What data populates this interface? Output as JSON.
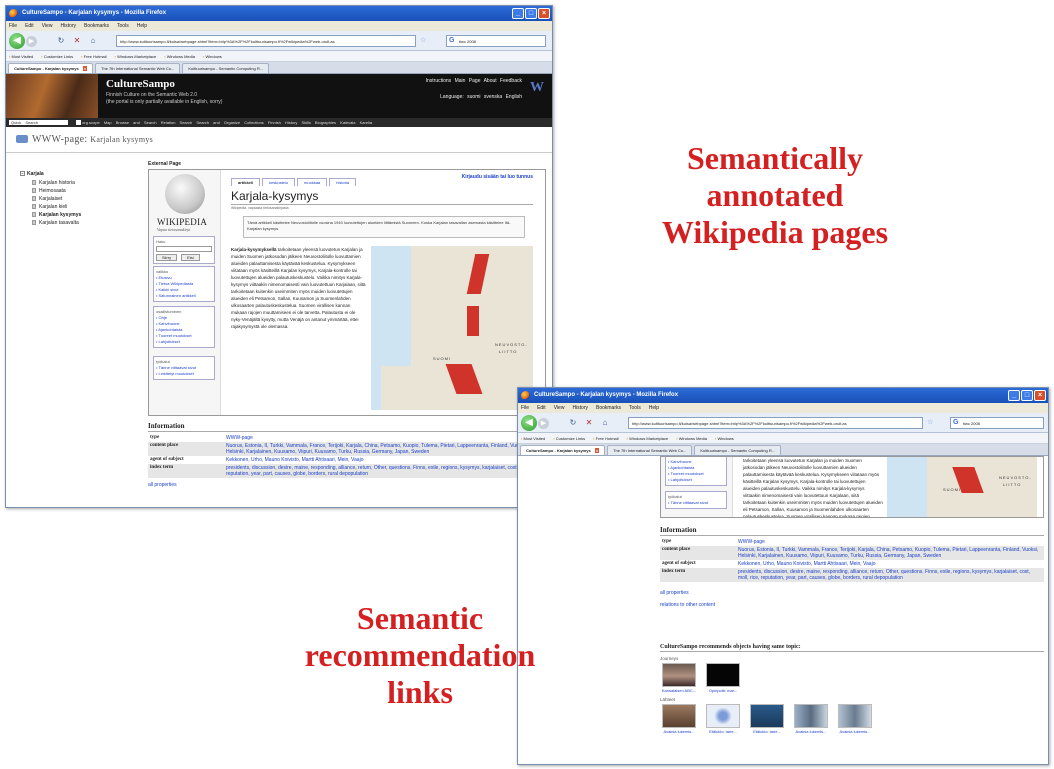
{
  "captions": {
    "top": [
      "Semantically",
      "annotated",
      "Wikipedia pages"
    ],
    "bottom": [
      "Semantic",
      "recommendation",
      "links"
    ]
  },
  "browser": {
    "title": "CultureSampo - Karjalan kysymys - Mozilla Firefox",
    "menu": [
      "File",
      "Edit",
      "View",
      "History",
      "Bookmarks",
      "Tools",
      "Help"
    ],
    "url": "http://www.kulttuurisampo.fi/kulsa/webpage.shtml?item=http%3A%2F%2Fkulttuurisampo.fi%2Fwikipedia%2Fweb-oruit.as",
    "search": "tiwc 2008",
    "bookmarks": [
      "Most Visited",
      "Customize Links",
      "Free Hotmail",
      "Windows Marketplace",
      "Windows Media",
      "Windows"
    ],
    "tabs": [
      {
        "label": "CultureSampo - Karjalan kysymys"
      },
      {
        "label": "The 7th International Semantic Web Co..."
      },
      {
        "label": "Kulttuurisampo - Semantic Computing R..."
      }
    ]
  },
  "site": {
    "brand": "CultureSampo",
    "tagline": "Finnish Culture on the Semantic Web 2.0",
    "tagline2": "(the portal is only partially available in English, sorry)",
    "toplinks": "Instructions  Main Page  About  Feedback",
    "langs": "Language: suomi  svenska  English",
    "search_label": "Quick Search",
    "nav": "Map Browse and Search  Relation Search  Search and Organize  Collections  Finnish History  Skills  Biographies  Kalevala  Karelia",
    "nav_checkbox": "org.scope",
    "page_prefix": "WWW-page:",
    "page_title": "Karjalan kysymys"
  },
  "tree": {
    "root": "Karjala",
    "items": [
      "Karjalan historia",
      "Heimosaata",
      "Karjalaiset",
      "Karjalan kieli",
      "Karjalan kysymys",
      "Karjalan tasavalta"
    ],
    "selected": 4
  },
  "external_label": "External Page",
  "wikipedia": {
    "name": "WIKIPEDIA",
    "slogan": "Vapaa tietosanakirja",
    "search_hd": "Haku",
    "go": "Siirry",
    "find": "Etsi",
    "nav_hd": "valikko",
    "nav_links": [
      "Etusivu",
      "Tietoa Wikipediasta",
      "Kaikki sivut",
      "Satunnainen artikkeli"
    ],
    "comm_hd": "osallistuminen",
    "comm_links": [
      "Ohje",
      "Kahvihuone",
      "Ajankohtaista",
      "Tuoreet muutokset",
      "Lahjoitukset"
    ],
    "tools_hd": "työkalut",
    "tools_links": [
      "Tänne viittaavat sivut",
      "Linkitetyt muutokset"
    ],
    "tabs": [
      "artikkeli",
      "keskustelu",
      "muokkaa",
      "historia"
    ],
    "user": "Kirjaudu sisään tai luo tunnus",
    "title": "Karjala-kysymys",
    "from": "Wikipedia, vapaasta tietosanakirjasta",
    "notice": "Tämä artikkeli käsittelee Neuvostoliitolle vuosina 1940 luovutettujen alueiden liittämistä Suomeen. Koska Karjalan tasavallan asemasta käsittelee Itä-Karjalan kysymys.",
    "text_bold": "Karjala-kysymyksellä",
    "text": "tarkoitetaan yleensä luovutetun Karjalan ja muiden Suomen jatkosodan jälkeen Neuvostoliitolle luovuttamien alueiden palauttamisesta käytävää keskustelua. Kysymykseen viitataan myös käsitteillä Karjalan kysymys, Karjala-kontrolle tai luovutettujen alueiden palautuskeskustelu. Vaikka nimitys Karjala-kysymys viittaakin nimenomaisesti vain luovutettuun Karjalaan, siitä tarkoitetaan kuitenkin useimmiten myös muiden luovutettujen alueiden eli Petsamon, Sallan, Kuusamon ja Suomenlahden ulkosaarten palautuskeskustelua. Suomen virallisen kannan mukaan rajojen muuttamiseen ei ole tarvetta. Palautusta ei ole nyky-Venäjältä kysytty, mutta Venäjä on antanut ymmärtää, ettei rajakysymystä ole olemassa.",
    "map_suomi": "SUOMI",
    "map_neuvosto": "NEUVOSTO-",
    "map_liitto": "LIITTO"
  },
  "information": {
    "heading": "Information",
    "rows": [
      {
        "key": "type",
        "value": "WWW-page"
      },
      {
        "key": "content place",
        "value": "Nuorus, Estonia, II, Turkki, Vammala, France, Terijoki, Karjala, China, Petsamo, Kuopio, Tulema, Pietari, Lappeenranta, Finland, Vuoksi, Helsinki, Karjalainen, Kuusamo, Viipuri, Kuusamo, Turku, Russia, Germany, Japan, Sweden"
      },
      {
        "key": "agent of subject",
        "value": "Kekkonen, Urho, Mauno Koivisto, Martti Ahtisaari, Mein, Vaajo"
      },
      {
        "key": "index term",
        "value": "presidents, discussion, desire, maine, responding, alliance, return, Other, questions, Finns, exile, regions, kysymys, karjalaiset, cost, moll, rice, reputation, year, part, causes, globe, borders, rural depopulation"
      }
    ],
    "all_properties": "all properties",
    "relations": "relations to other content"
  },
  "recommendations": {
    "heading": "CultureSampo recommends objects having same topic:",
    "cat1": "Journeys",
    "group1": [
      {
        "label": "Kansalaisen ABC..."
      },
      {
        "label": "Opinpotti: mar..."
      }
    ],
    "cat2": "Lähteet",
    "group2": [
      {
        "label": "Avainia lukemis..."
      },
      {
        "label": "Etälukio: tarie..."
      },
      {
        "label": "Etälukio: tarie..."
      },
      {
        "label": "Avainia lukemis..."
      },
      {
        "label": "Avainia lukemis..."
      }
    ]
  }
}
